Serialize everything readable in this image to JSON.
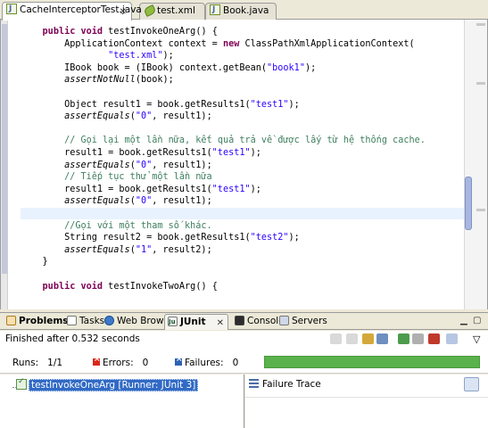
{
  "editor_tabs": [
    {
      "label": "CacheInterceptorTest.java",
      "icon": "java-file-icon",
      "active": true,
      "close": "✕"
    },
    {
      "label": "test.xml",
      "icon": "xml-file-icon",
      "active": false
    },
    {
      "label": "Book.java",
      "icon": "java-file-icon",
      "active": false
    }
  ],
  "code_lines": [
    "    public void testInvokeOneArg() {",
    "        ApplicationContext context = new ClassPathXmlApplicationContext(",
    "                \"test.xml\");",
    "        IBook book = (IBook) context.getBean(\"book1\");",
    "        assertNotNull(book);",
    "",
    "        Object result1 = book.getResults1(\"test1\");",
    "        assertEquals(\"0\", result1);",
    "",
    "        // Gọi lại một lần nữa, kết quả trả về được lấy từ hệ thống cache.",
    "        result1 = book.getResults1(\"test1\");",
    "        assertEquals(\"0\", result1);",
    "        // Tiếp tục thử một lần nữa",
    "        result1 = book.getResults1(\"test1\");",
    "        assertEquals(\"0\", result1);",
    "",
    "        //Gọi với một tham số khác.",
    "        String result2 = book.getResults1(\"test2\");",
    "        assertEquals(\"1\", result2);",
    "    }",
    "",
    "    public void testInvokeTwoArg() {"
  ],
  "view_tabs": [
    {
      "label": "Problems",
      "icon": "problems-icon",
      "active": false
    },
    {
      "label": "Tasks",
      "icon": "tasks-icon",
      "active": false
    },
    {
      "label": "Web Browser",
      "icon": "web-browser-icon",
      "active": false
    },
    {
      "label": "JUnit",
      "icon": "junit-icon",
      "active": true,
      "close": "✕"
    },
    {
      "label": "Console",
      "icon": "console-icon",
      "active": false
    },
    {
      "label": "Servers",
      "icon": "servers-icon",
      "active": false
    }
  ],
  "junit": {
    "status": "Finished after 0.532 seconds",
    "runs_label": "Runs:",
    "runs_value": "1/1",
    "errors_label": "Errors:",
    "errors_value": "0",
    "failures_label": "Failures:",
    "failures_value": "0",
    "progress_color": "#5ab24c",
    "progress_fraction": 1.0,
    "test_name": "testInvokeOneArg [Runner: JUnit 3]",
    "failure_trace_label": "Failure Trace"
  },
  "colors": {
    "keyword": "#7f0055",
    "string": "#2a00ff",
    "comment": "#3f7f5f",
    "current_line": "#e8f2fe",
    "selection": "#316ac5"
  }
}
